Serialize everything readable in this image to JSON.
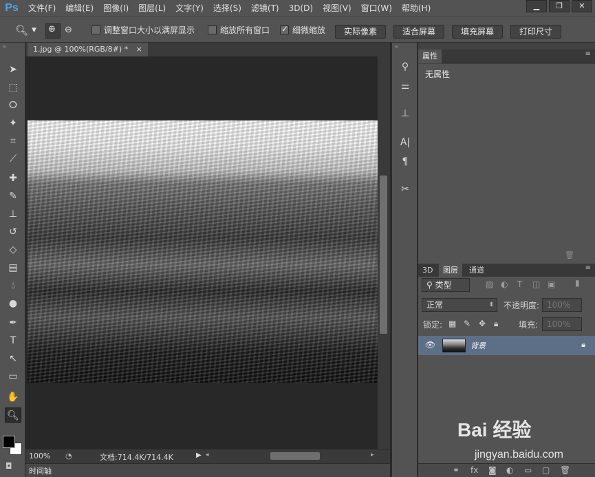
{
  "app": {
    "logo": "Ps"
  },
  "menu": [
    "文件(F)",
    "编辑(E)",
    "图像(I)",
    "图层(L)",
    "文字(Y)",
    "选择(S)",
    "滤镜(T)",
    "3D(D)",
    "视图(V)",
    "窗口(W)",
    "帮助(H)"
  ],
  "window_controls": {
    "minimize": "▁",
    "restore": "❐",
    "close": "✕"
  },
  "options": {
    "resize_windows": "调整窗口大小以满屏显示",
    "zoom_all": "缩放所有窗口",
    "scrubby_zoom": "细微缩放",
    "btn_actual": "实际像素",
    "btn_fit": "适合屏幕",
    "btn_fill": "填充屏幕",
    "btn_print": "打印尺寸",
    "resize_windows_checked": false,
    "zoom_all_checked": false,
    "scrubby_zoom_checked": true
  },
  "document": {
    "tab_title": "1.jpg @ 100%(RGB/8#) *",
    "close": "×"
  },
  "status": {
    "zoom": "100%",
    "doc_info": "文档:714.4K/714.4K"
  },
  "timeline": {
    "tab": "时间轴"
  },
  "properties": {
    "tab": "属性",
    "label": "无属性"
  },
  "layers": {
    "tabs": [
      "3D",
      "图层",
      "通道"
    ],
    "filter_kind": "类型",
    "blend_mode": "正常",
    "opacity_label": "不透明度:",
    "opacity_value": "100%",
    "lock_label": "锁定:",
    "fill_label": "填充:",
    "fill_value": "100%",
    "layer_name": "背景"
  },
  "watermark": {
    "brand": "Bai 经验",
    "url": "jingyan.baidu.com"
  }
}
